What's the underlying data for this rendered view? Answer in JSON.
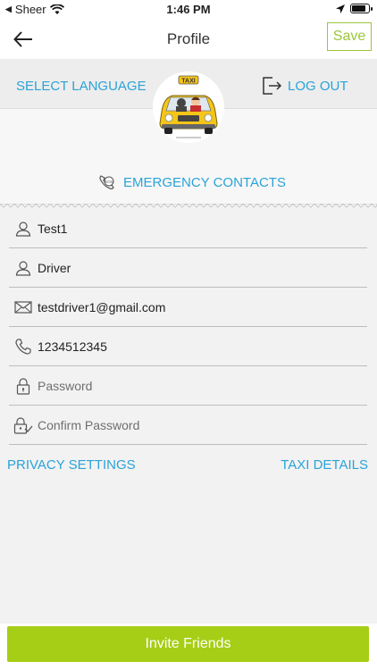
{
  "status_bar": {
    "back_app": "Sheer",
    "time": "1:46 PM"
  },
  "nav": {
    "title": "Profile",
    "save_label": "Save"
  },
  "header": {
    "select_language": "SELECT LANGUAGE",
    "log_out": "LOG OUT",
    "emergency_contacts": "EMERGENCY CONTACTS",
    "avatar_icon": "taxi-driver-icon",
    "accent_color": "#2aa3d8"
  },
  "form": {
    "first_name": {
      "value": "Test1",
      "placeholder": ""
    },
    "last_name": {
      "value": "Driver",
      "placeholder": ""
    },
    "email": {
      "value": "testdriver1@gmail.com",
      "placeholder": ""
    },
    "phone": {
      "value": "1234512345",
      "placeholder": ""
    },
    "password": {
      "value": "",
      "placeholder": "Password"
    },
    "confirm_password": {
      "value": "",
      "placeholder": "Confirm Password"
    }
  },
  "links": {
    "privacy_settings": "PRIVACY SETTINGS",
    "taxi_details": "TAXI DETAILS"
  },
  "bottom": {
    "invite_label": "Invite Friends",
    "button_color": "#a6ce16"
  }
}
